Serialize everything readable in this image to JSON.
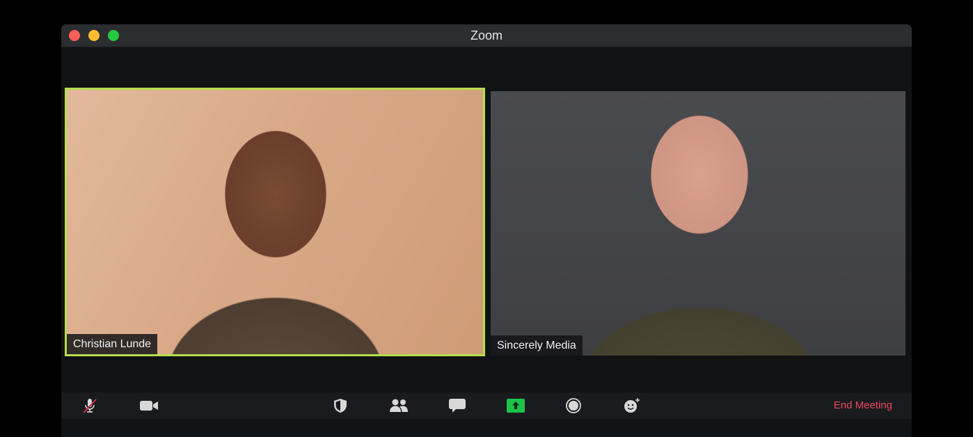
{
  "window": {
    "title": "Zoom"
  },
  "participants": [
    {
      "name": "Christian Lunde",
      "active_speaker": true
    },
    {
      "name": "Sincerely Media",
      "active_speaker": false
    }
  ],
  "toolbar": {
    "icons": [
      "mic-muted-icon",
      "video-icon",
      "security-shield-icon",
      "participants-icon",
      "chat-icon",
      "share-screen-icon",
      "record-icon",
      "reactions-icon"
    ],
    "end_meeting_label": "End Meeting"
  },
  "colors": {
    "active_speaker_border": "#b6dd4d",
    "share_screen": "#1bc24a",
    "end_meeting": "#f0485b"
  }
}
